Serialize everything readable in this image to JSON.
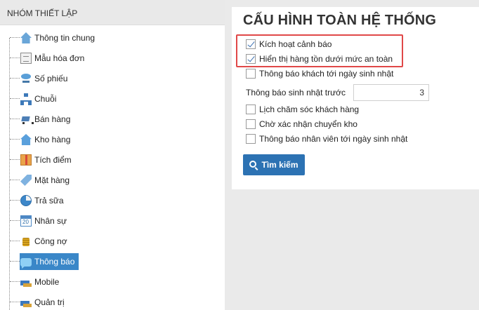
{
  "sidebar": {
    "header": "NHÓM THIẾT LẬP",
    "items": [
      {
        "label": "Thông tin chung",
        "icon": "home-icon"
      },
      {
        "label": "Mẫu hóa đơn",
        "icon": "document-icon"
      },
      {
        "label": "Số phiếu",
        "icon": "network-icon"
      },
      {
        "label": "Chuỗi",
        "icon": "hierarchy-icon"
      },
      {
        "label": "Bán hàng",
        "icon": "cart-icon"
      },
      {
        "label": "Kho hàng",
        "icon": "warehouse-icon"
      },
      {
        "label": "Tích điểm",
        "icon": "gift-icon"
      },
      {
        "label": "Mặt hàng",
        "icon": "tag-icon"
      },
      {
        "label": "Trả sữa",
        "icon": "pie-chart-icon"
      },
      {
        "label": "Nhân sự",
        "icon": "calendar-icon"
      },
      {
        "label": "Công nợ",
        "icon": "coins-icon"
      },
      {
        "label": "Thông báo",
        "icon": "chat-bubble-icon",
        "active": true
      },
      {
        "label": "Mobile",
        "icon": "devices-icon"
      },
      {
        "label": "Quản trị",
        "icon": "admin-icon"
      }
    ]
  },
  "main": {
    "title": "CẤU HÌNH TOÀN HỆ THỐNG",
    "options": [
      {
        "label": "Kích hoạt cảnh báo",
        "checked": true
      },
      {
        "label": "Hiển thị hàng tồn dưới mức an toàn",
        "checked": true
      },
      {
        "label": "Thông báo khách tới ngày sinh nhật",
        "checked": false
      }
    ],
    "birthday_notice": {
      "label": "Thông báo sinh nhật trước",
      "value": "3"
    },
    "options2": [
      {
        "label": "Lịch chăm sóc khách hàng",
        "checked": false
      },
      {
        "label": "Chờ xác nhận chuyển kho",
        "checked": false
      },
      {
        "label": "Thông báo nhân viên tới ngày sinh nhật",
        "checked": false
      }
    ],
    "search_button": "Tìm kiếm",
    "accent_color": "#2c72b3",
    "highlight_color": "#e04848"
  }
}
